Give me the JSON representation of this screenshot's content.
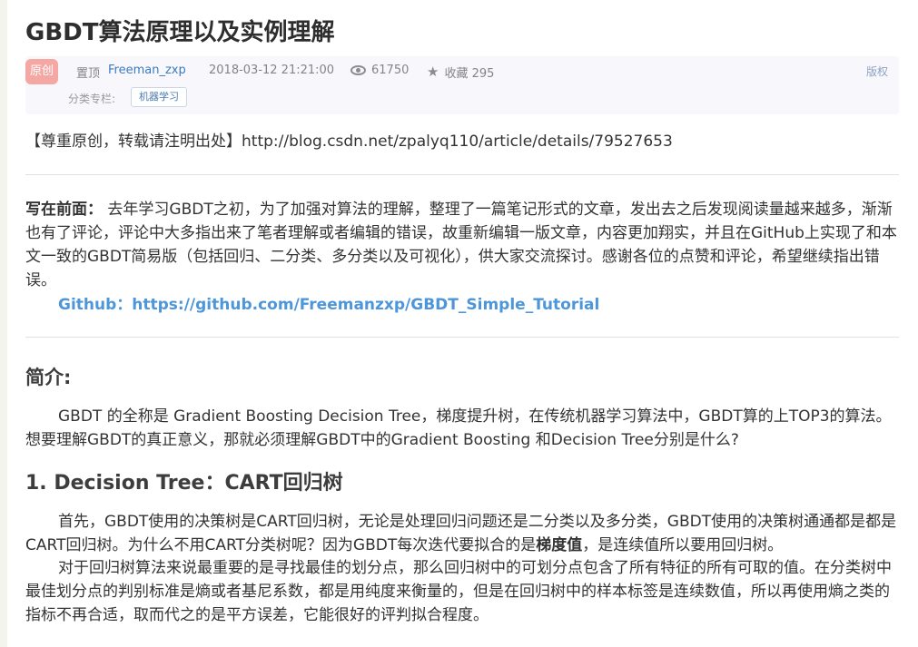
{
  "article": {
    "title": "GBDT算法原理以及实例理解"
  },
  "meta": {
    "original_badge": "原创",
    "pinned": "置顶",
    "author": "Freeman_zxp",
    "date": "2018-03-12 21:21:00",
    "views": "61750",
    "favorites": "收藏 295",
    "copyright": "版权",
    "category_label": "分类专栏:",
    "category_tag": "机器学习",
    "icons": {
      "views": "eye-icon",
      "favorites": "star-icon"
    }
  },
  "body": {
    "source_note": "【尊重原创，转载请注明出处】http://blog.csdn.net/zpalyq110/article/details/79527653",
    "preface_label": "写在前面：",
    "preface_text": " 去年学习GBDT之初，为了加强对算法的理解，整理了一篇笔记形式的文章，发出去之后发现阅读量越来越多，渐渐也有了评论，评论中大多指出来了笔者理解或者编辑的错误，故重新编辑一版文章，内容更加翔实，并且在GitHub上实现了和本文一致的GBDT简易版（包括回归、二分类、多分类以及可视化），供大家交流探讨。感谢各位的点赞和评论，希望继续指出错误。",
    "github_link": "Github：https://github.com/Freemanzxp/GBDT_Simple_Tutorial",
    "intro_heading": "简介:",
    "intro_para": "GBDT 的全称是 Gradient Boosting Decision Tree，梯度提升树，在传统机器学习算法中，GBDT算的上TOP3的算法。想要理解GBDT的真正意义，那就必须理解GBDT中的Gradient Boosting 和Decision Tree分别是什么?",
    "section1_heading": "1. Decision Tree：CART回归树",
    "s1_para1_a": "首先，GBDT使用的决策树是CART回归树，无论是处理回归问题还是二分类以及多分类，GBDT使用的决策树通通都是都是CART回归树。为什么不用CART分类树呢？因为GBDT每次迭代要拟合的是",
    "s1_para1_bold": "梯度值",
    "s1_para1_b": "，是连续值所以要用回归树。",
    "s1_para2": "对于回归树算法来说最重要的是寻找最佳的划分点，那么回归树中的可划分点包含了所有特征的所有可取的值。在分类树中最佳划分点的判别标准是熵或者基尼系数，都是用纯度来衡量的，但是在回归树中的样本标签是连续数值，所以再使用熵之类的指标不再合适，取而代之的是平方误差，它能很好的评判拟合程度。"
  }
}
